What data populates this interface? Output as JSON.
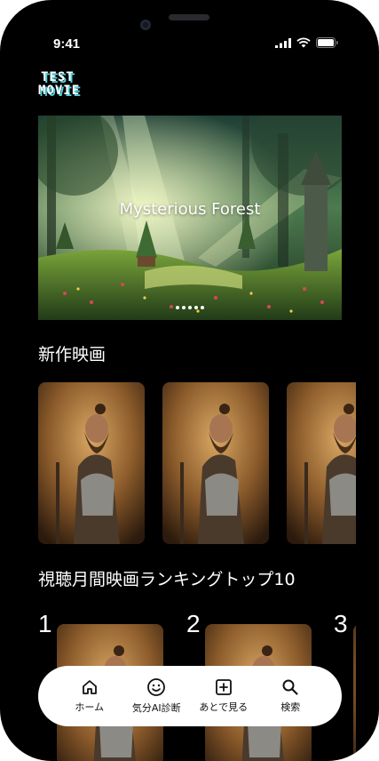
{
  "status": {
    "time": "9:41"
  },
  "logo": {
    "line1": "TEST",
    "line2": "MOVIE"
  },
  "hero": {
    "title": "Mysterious Forest",
    "dot_count": 5
  },
  "sections": {
    "new_movies": {
      "title": "新作映画"
    },
    "ranking": {
      "title": "視聴月間映画ランキングトップ10",
      "numbers": [
        "1",
        "2",
        "3"
      ]
    }
  },
  "nav": {
    "items": [
      {
        "label": "ホーム",
        "icon": "home-icon"
      },
      {
        "label": "気分AI診断",
        "icon": "smiley-icon"
      },
      {
        "label": "あとで見る",
        "icon": "plus-box-icon"
      },
      {
        "label": "検索",
        "icon": "search-icon"
      }
    ]
  },
  "colors": {
    "background": "#000000",
    "nav_background": "#ffffff",
    "logo_accent": "#4fd4e0"
  }
}
